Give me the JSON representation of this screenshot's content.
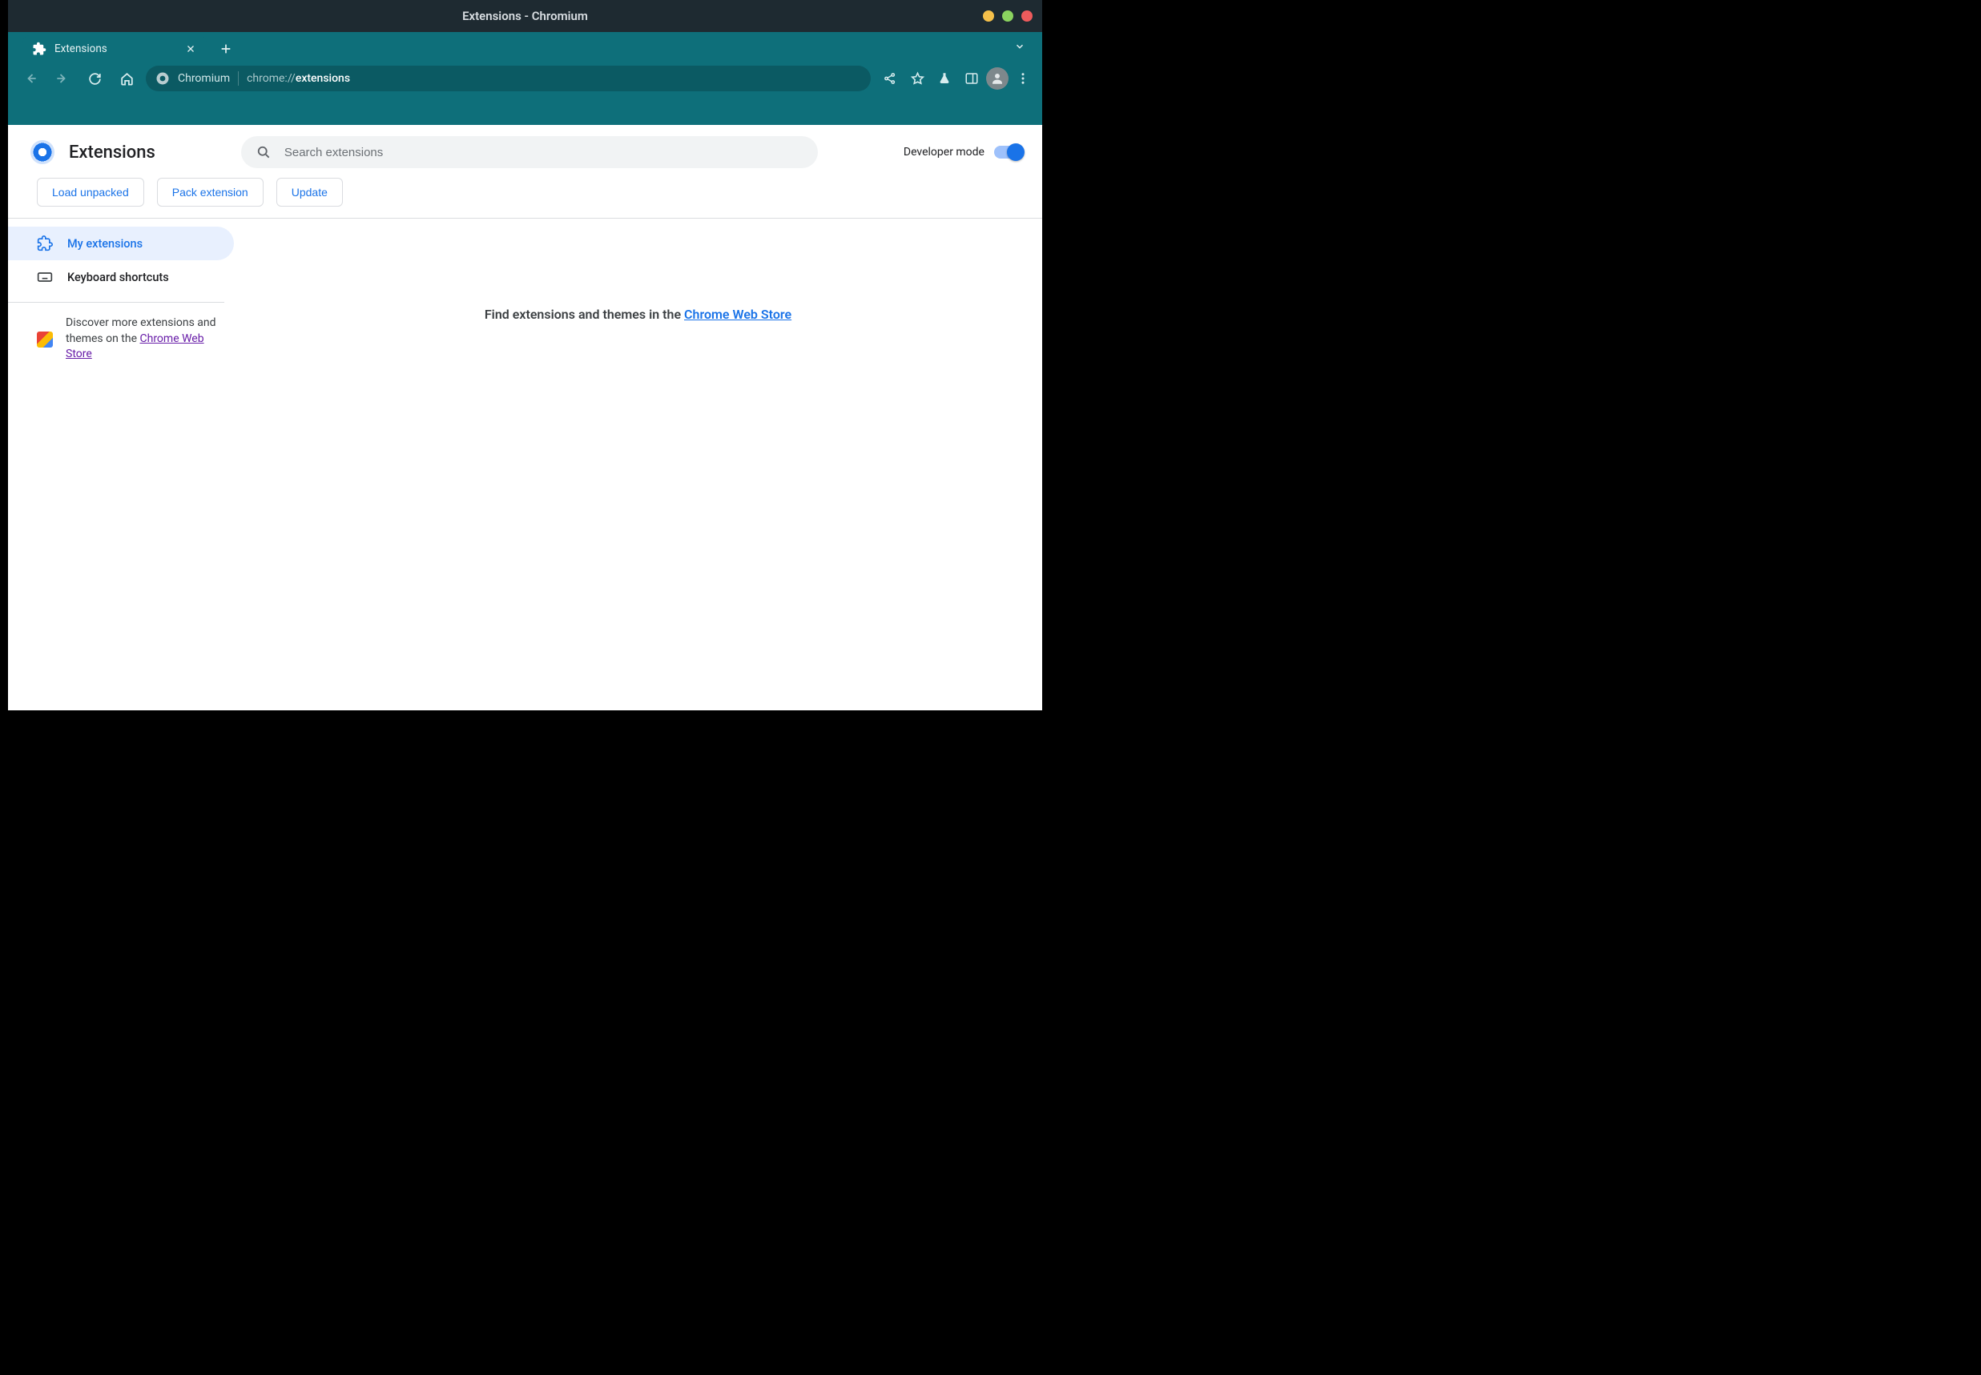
{
  "window": {
    "title": "Extensions - Chromium",
    "buttons": {
      "min": "#f5c04a",
      "max": "#8bd35f",
      "close": "#ee5b5c"
    }
  },
  "tab": {
    "title": "Extensions"
  },
  "omnibox": {
    "site_label": "Chromium",
    "url_scheme": "chrome://",
    "url_path": "extensions"
  },
  "ext_header": {
    "title": "Extensions",
    "search_placeholder": "Search extensions",
    "devmode_label": "Developer mode"
  },
  "dev_actions": {
    "load": "Load unpacked",
    "pack": "Pack extension",
    "update": "Update"
  },
  "sidebar": {
    "items": [
      {
        "label": "My extensions"
      },
      {
        "label": "Keyboard shortcuts"
      }
    ],
    "promo_prefix": "Discover more extensions and themes on the ",
    "promo_link": "Chrome Web Store"
  },
  "main": {
    "empty_prefix": "Find extensions and themes in the ",
    "empty_link": "Chrome Web Store"
  }
}
